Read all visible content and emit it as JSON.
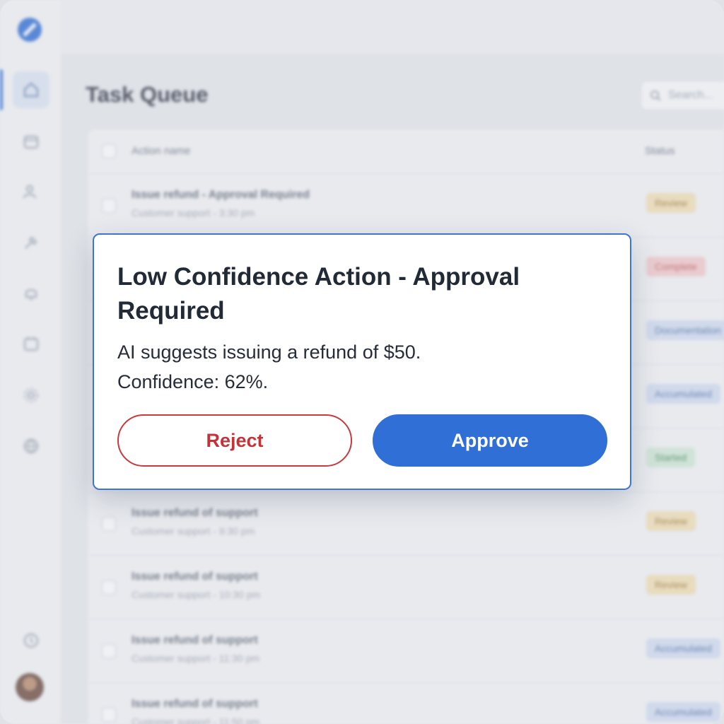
{
  "page": {
    "title": "Task Queue",
    "search_placeholder": "Search..."
  },
  "table": {
    "columns": [
      "Action name",
      "Status"
    ],
    "rows": [
      {
        "title": "Issue refund - Approval Required",
        "subtitle": "Customer support - 3:30 pm",
        "status": "Review",
        "status_color": "#f4e2b6"
      },
      {
        "title": "",
        "subtitle": "",
        "status": "Complete",
        "status_color": "#f6cccd"
      },
      {
        "title": "",
        "subtitle": "",
        "status": "Documentation",
        "status_color": "#d4dff3"
      },
      {
        "title": "",
        "subtitle": "",
        "status": "Accumulated",
        "status_color": "#d4dff3"
      },
      {
        "title": "",
        "subtitle": "",
        "status": "Started",
        "status_color": "#d3ecd9"
      },
      {
        "title": "Issue refund of support",
        "subtitle": "Customer support - 9:30 pm",
        "status": "Review",
        "status_color": "#f4e2b6"
      },
      {
        "title": "Issue refund of support",
        "subtitle": "Customer support - 10:30 pm",
        "status": "Review",
        "status_color": "#f4e2b6"
      },
      {
        "title": "Issue refund of support",
        "subtitle": "Customer support - 11:30 pm",
        "status": "Accumulated",
        "status_color": "#d4dff3"
      },
      {
        "title": "Issue refund of support",
        "subtitle": "Customer support - 11:50 pm",
        "status": "Accumulated",
        "status_color": "#d4dff3"
      }
    ]
  },
  "sidebar": {
    "items": [
      "home-icon",
      "inbox-icon",
      "users-icon",
      "tools-icon",
      "bell-icon",
      "calendar-icon",
      "settings-icon",
      "globe-icon"
    ],
    "footer_items": [
      "help-icon"
    ],
    "active_index": 0
  },
  "modal": {
    "title": "Low Confidence Action - Approval Required",
    "body_line1": "AI suggests issuing a refund of $50.",
    "body_line2": "Confidence: 62%.",
    "reject_label": "Reject",
    "approve_label": "Approve"
  },
  "colors": {
    "accent": "#2f6fd6",
    "danger": "#c3343a"
  }
}
